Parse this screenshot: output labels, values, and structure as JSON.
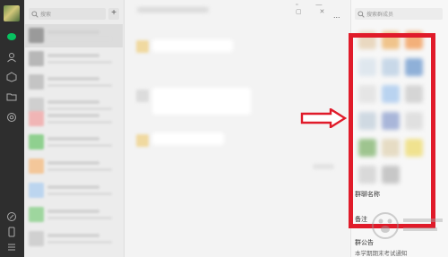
{
  "sidebar": {
    "search_placeholder": "搜索",
    "add_label": "+"
  },
  "chat": {
    "more_label": "..."
  },
  "window": {
    "controls": "▫ — ▢ ✕"
  },
  "members": {
    "search_placeholder": "搜索群成员"
  },
  "group": {
    "name_label": "群聊名称",
    "remark_label": "备注",
    "notice_label": "群公告",
    "notice_text": "本学期期末考试通知"
  },
  "colors": {
    "highlight": "#e01b2a",
    "nav_bg": "#2e2e2e",
    "active_green": "#07c160"
  }
}
